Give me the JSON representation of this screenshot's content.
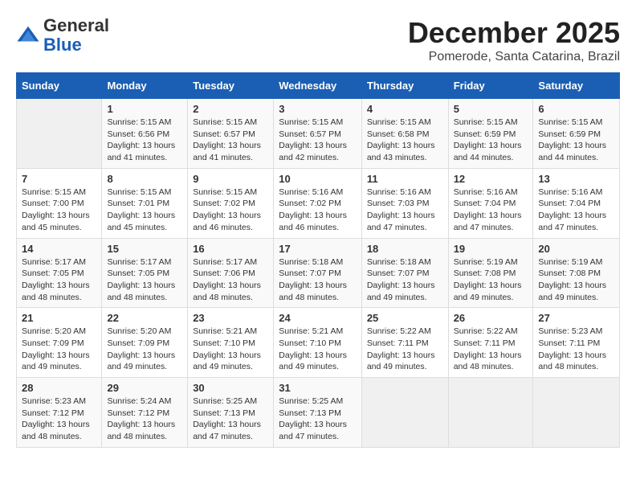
{
  "logo": {
    "general": "General",
    "blue": "Blue"
  },
  "header": {
    "title": "December 2025",
    "subtitle": "Pomerode, Santa Catarina, Brazil"
  },
  "weekdays": [
    "Sunday",
    "Monday",
    "Tuesday",
    "Wednesday",
    "Thursday",
    "Friday",
    "Saturday"
  ],
  "weeks": [
    [
      {
        "day": "",
        "info": ""
      },
      {
        "day": "1",
        "info": "Sunrise: 5:15 AM\nSunset: 6:56 PM\nDaylight: 13 hours\nand 41 minutes."
      },
      {
        "day": "2",
        "info": "Sunrise: 5:15 AM\nSunset: 6:57 PM\nDaylight: 13 hours\nand 41 minutes."
      },
      {
        "day": "3",
        "info": "Sunrise: 5:15 AM\nSunset: 6:57 PM\nDaylight: 13 hours\nand 42 minutes."
      },
      {
        "day": "4",
        "info": "Sunrise: 5:15 AM\nSunset: 6:58 PM\nDaylight: 13 hours\nand 43 minutes."
      },
      {
        "day": "5",
        "info": "Sunrise: 5:15 AM\nSunset: 6:59 PM\nDaylight: 13 hours\nand 44 minutes."
      },
      {
        "day": "6",
        "info": "Sunrise: 5:15 AM\nSunset: 6:59 PM\nDaylight: 13 hours\nand 44 minutes."
      }
    ],
    [
      {
        "day": "7",
        "info": "Sunrise: 5:15 AM\nSunset: 7:00 PM\nDaylight: 13 hours\nand 45 minutes."
      },
      {
        "day": "8",
        "info": "Sunrise: 5:15 AM\nSunset: 7:01 PM\nDaylight: 13 hours\nand 45 minutes."
      },
      {
        "day": "9",
        "info": "Sunrise: 5:15 AM\nSunset: 7:02 PM\nDaylight: 13 hours\nand 46 minutes."
      },
      {
        "day": "10",
        "info": "Sunrise: 5:16 AM\nSunset: 7:02 PM\nDaylight: 13 hours\nand 46 minutes."
      },
      {
        "day": "11",
        "info": "Sunrise: 5:16 AM\nSunset: 7:03 PM\nDaylight: 13 hours\nand 47 minutes."
      },
      {
        "day": "12",
        "info": "Sunrise: 5:16 AM\nSunset: 7:04 PM\nDaylight: 13 hours\nand 47 minutes."
      },
      {
        "day": "13",
        "info": "Sunrise: 5:16 AM\nSunset: 7:04 PM\nDaylight: 13 hours\nand 47 minutes."
      }
    ],
    [
      {
        "day": "14",
        "info": "Sunrise: 5:17 AM\nSunset: 7:05 PM\nDaylight: 13 hours\nand 48 minutes."
      },
      {
        "day": "15",
        "info": "Sunrise: 5:17 AM\nSunset: 7:05 PM\nDaylight: 13 hours\nand 48 minutes."
      },
      {
        "day": "16",
        "info": "Sunrise: 5:17 AM\nSunset: 7:06 PM\nDaylight: 13 hours\nand 48 minutes."
      },
      {
        "day": "17",
        "info": "Sunrise: 5:18 AM\nSunset: 7:07 PM\nDaylight: 13 hours\nand 48 minutes."
      },
      {
        "day": "18",
        "info": "Sunrise: 5:18 AM\nSunset: 7:07 PM\nDaylight: 13 hours\nand 49 minutes."
      },
      {
        "day": "19",
        "info": "Sunrise: 5:19 AM\nSunset: 7:08 PM\nDaylight: 13 hours\nand 49 minutes."
      },
      {
        "day": "20",
        "info": "Sunrise: 5:19 AM\nSunset: 7:08 PM\nDaylight: 13 hours\nand 49 minutes."
      }
    ],
    [
      {
        "day": "21",
        "info": "Sunrise: 5:20 AM\nSunset: 7:09 PM\nDaylight: 13 hours\nand 49 minutes."
      },
      {
        "day": "22",
        "info": "Sunrise: 5:20 AM\nSunset: 7:09 PM\nDaylight: 13 hours\nand 49 minutes."
      },
      {
        "day": "23",
        "info": "Sunrise: 5:21 AM\nSunset: 7:10 PM\nDaylight: 13 hours\nand 49 minutes."
      },
      {
        "day": "24",
        "info": "Sunrise: 5:21 AM\nSunset: 7:10 PM\nDaylight: 13 hours\nand 49 minutes."
      },
      {
        "day": "25",
        "info": "Sunrise: 5:22 AM\nSunset: 7:11 PM\nDaylight: 13 hours\nand 49 minutes."
      },
      {
        "day": "26",
        "info": "Sunrise: 5:22 AM\nSunset: 7:11 PM\nDaylight: 13 hours\nand 48 minutes."
      },
      {
        "day": "27",
        "info": "Sunrise: 5:23 AM\nSunset: 7:11 PM\nDaylight: 13 hours\nand 48 minutes."
      }
    ],
    [
      {
        "day": "28",
        "info": "Sunrise: 5:23 AM\nSunset: 7:12 PM\nDaylight: 13 hours\nand 48 minutes."
      },
      {
        "day": "29",
        "info": "Sunrise: 5:24 AM\nSunset: 7:12 PM\nDaylight: 13 hours\nand 48 minutes."
      },
      {
        "day": "30",
        "info": "Sunrise: 5:25 AM\nSunset: 7:13 PM\nDaylight: 13 hours\nand 47 minutes."
      },
      {
        "day": "31",
        "info": "Sunrise: 5:25 AM\nSunset: 7:13 PM\nDaylight: 13 hours\nand 47 minutes."
      },
      {
        "day": "",
        "info": ""
      },
      {
        "day": "",
        "info": ""
      },
      {
        "day": "",
        "info": ""
      }
    ]
  ]
}
